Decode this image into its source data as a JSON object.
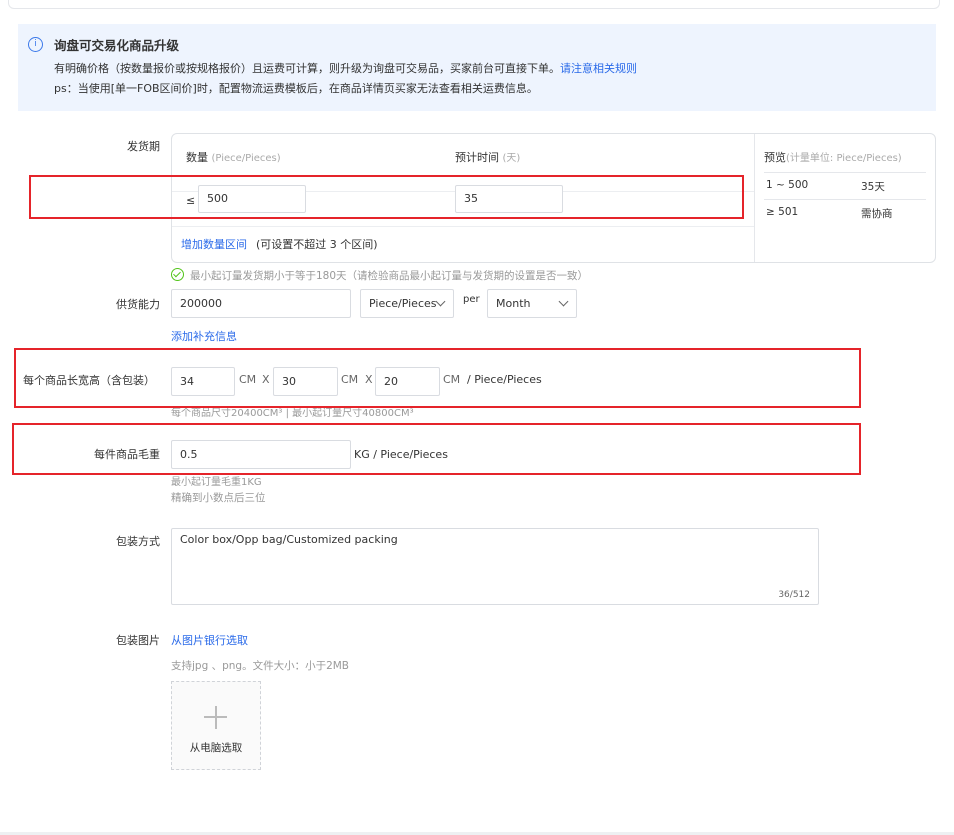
{
  "notice": {
    "title": "询盘可交易化商品升级",
    "line1": "有明确价格（按数量报价或按规格报价）且运费可计算，则升级为询盘可交易品，买家前台可直接下单。",
    "line1_link": "请注意相关规则",
    "line2": "ps：当使用[单一FOB区间价]时，配置物流运费模板后，在商品详情页买家无法查看相关运费信息。"
  },
  "delivery": {
    "label": "发货期",
    "qty_header": "数量",
    "qty_unit": "(Piece/Pieces)",
    "time_header": "预计时间",
    "time_unit": "(天)",
    "le_symbol": "≤",
    "qty_value": "500",
    "time_value": "35",
    "add_range_link": "增加数量区间",
    "add_range_hint": "(可设置不超过 3 个区间)",
    "preview_title": "预览",
    "preview_unit": "(计量单位: Piece/Pieces)",
    "preview_rows": [
      {
        "range": "1 ~ 500",
        "time": "35天"
      },
      {
        "range": "≥ 501",
        "time": "需协商"
      }
    ],
    "check_msg": "最小起订量发货期小于等于180天（请检验商品最小起订量与发货期的设置是否一致）"
  },
  "supply": {
    "label": "供货能力",
    "value": "200000",
    "unit": "Piece/Pieces",
    "per": "per",
    "period": "Month",
    "add_info_link": "添加补充信息"
  },
  "dimensions": {
    "label": "每个商品长宽高（含包装）",
    "length": "34",
    "width": "30",
    "height": "20",
    "unit": "CM",
    "x": "X",
    "suffix": "/ Piece/Pieces",
    "hint": "每个商品尺寸20400CM³ | 最小起订量尺寸40800CM³"
  },
  "weight": {
    "label": "每件商品毛重",
    "value": "0.5",
    "suffix": "KG / Piece/Pieces",
    "hint1": "最小起订量毛重1KG",
    "hint2": "精确到小数点后三位"
  },
  "packing": {
    "label": "包装方式",
    "value": "Color box/Opp bag/Customized packing",
    "counter": "36/512"
  },
  "packing_image": {
    "label": "包装图片",
    "bank_link": "从图片银行选取",
    "hint": "支持jpg 、png。文件大小：小于2MB",
    "upload_label": "从电脑选取"
  },
  "colors": {
    "accent": "#2a6ae9",
    "highlight": "#e5242a",
    "notice_bg": "#eef4fe",
    "success": "#52c41a"
  }
}
